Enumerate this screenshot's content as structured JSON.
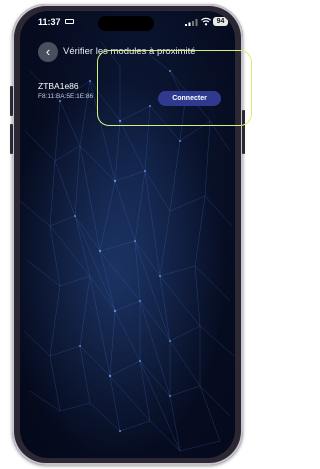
{
  "status_bar": {
    "time": "11:37",
    "battery": "94"
  },
  "header": {
    "title": "Vérifier les modules à proximité"
  },
  "device": {
    "name": "ZTBA1e86",
    "mac": "F8:11:BA:5E:1E:86",
    "connect_label": "Connecter"
  },
  "colors": {
    "background": "#070d22",
    "connect_button": "#2f3a8f",
    "highlight": "#d8ef7a"
  },
  "icons": {
    "back": "chevron-left-icon",
    "wifi": "wifi-icon",
    "signal": "cellular-signal-icon",
    "battery": "battery-icon"
  }
}
